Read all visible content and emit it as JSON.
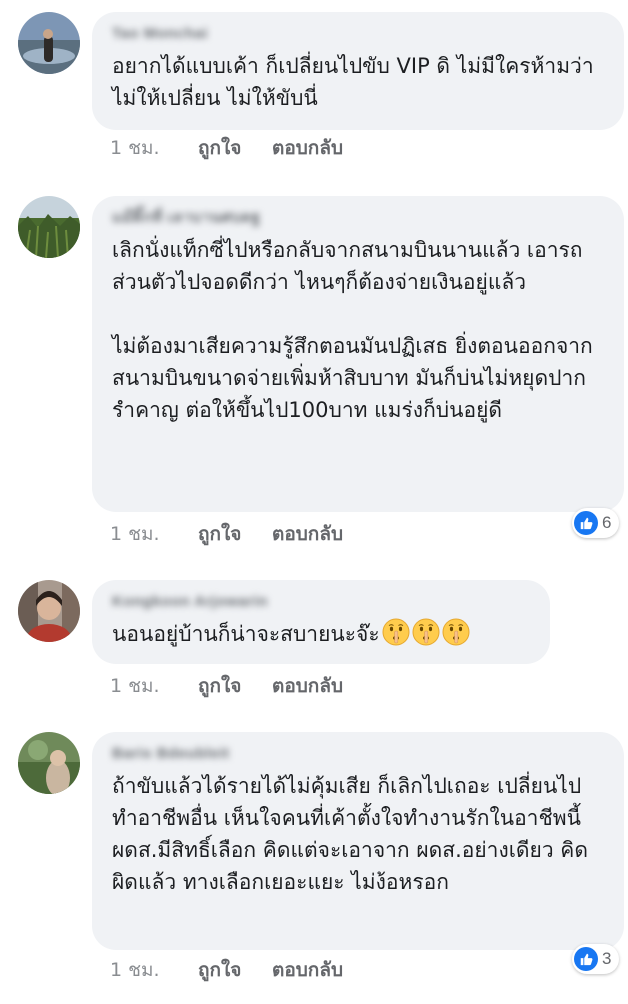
{
  "comments": [
    {
      "author": "Tao Monchai",
      "text": "อยากได้แบบเค้า ก็เปลี่ยนไปขับ VIP ดิ ไม่มีใครห้ามว่าไม่ให้เปลี่ยน ไม่ให้ขับนี่",
      "time": "1 ชม.",
      "like_label": "ถูกใจ",
      "reply_label": "ตอบกลับ"
    },
    {
      "author": "แม๊ติ๊กที่ เลาบานศบดฐ",
      "text": "เลิกนั่งแท็กซี่ไปหรือกลับจากสนามบินนานแล้ว เอารถส่วนตัวไปจอดดีกว่า ไหนๆก็ต้องจ่ายเงินอยู่แล้ว\n\nไม่ต้องมาเสียความรู้สึกตอนมันปฏิเสธ ยิ่งตอนออกจากสนามบินขนาดจ่ายเพิ่มห้าสิบบาท มันก็บ่นไม่หยุดปาก รำคาญ ต่อให้ขึ้นไป100บาท แมร่งก็บ่นอยู่ดี",
      "time": "1 ชม.",
      "like_label": "ถูกใจ",
      "reply_label": "ตอบกลับ",
      "reaction_count": "6"
    },
    {
      "author": "Kongkoon Arjowarin",
      "text": "นอนอยู่บ้านก็น่าจะสบายนะจ๊ะ",
      "emoji": [
        "shushing-face-icon",
        "shushing-face-icon",
        "shushing-face-icon"
      ],
      "time": "1 ชม.",
      "like_label": "ถูกใจ",
      "reply_label": "ตอบกลับ"
    },
    {
      "author": "Baris Bdeubleit",
      "text": "ถ้าขับแล้วได้รายได้ไม่คุ้มเสีย ก็เลิกไปเถอะ เปลี่ยนไปทำอาชีพอื่น เห็นใจคนที่เค้าตั้งใจทำงานรักในอาชีพนี้ ผดส.มีสิทธิ์เลือก คิดแต่จะเอาจาก ผดส.อย่างเดียว คิดผิดแล้ว ทางเลือกเยอะแยะ ไม่ง้อหรอก",
      "time": "1 ชม.",
      "like_label": "ถูกใจ",
      "reply_label": "ตอบกลับ",
      "reaction_count": "3"
    }
  ],
  "colors": {
    "bubble": "#f0f2f5",
    "like_blue": "#1877f2",
    "meta_gray": "#65676b"
  }
}
